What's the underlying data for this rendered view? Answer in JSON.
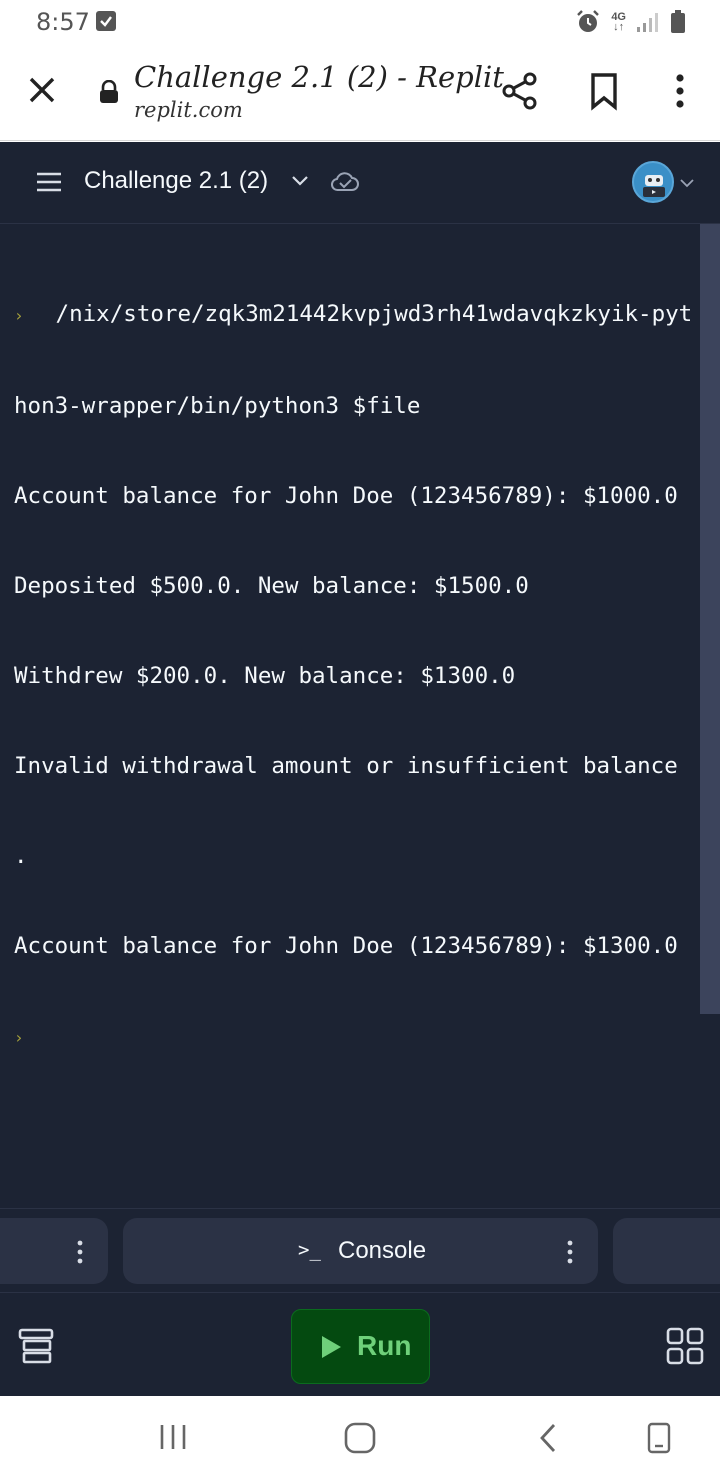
{
  "status_bar": {
    "time": "8:57",
    "network": "4G"
  },
  "browser": {
    "page_title": "Challenge 2.1 (2) - Replit",
    "url": "replit.com"
  },
  "replit": {
    "repl_name": "Challenge 2.1 (2)",
    "accent_color": "#1c2333"
  },
  "console": {
    "lines": [
      " /nix/store/zqk3m21442kvpjwd3rh41wdavqkzkyik-pyt",
      "hon3-wrapper/bin/python3 $file",
      "Account balance for John Doe (123456789): $1000.0",
      "Deposited $500.0. New balance: $1500.0",
      "Withdrew $200.0. New balance: $1300.0",
      "Invalid withdrawal amount or insufficient balance",
      ".",
      "Account balance for John Doe (123456789): $1300.0"
    ]
  },
  "tabs": {
    "console_label": "Console"
  },
  "toolbar": {
    "run_label": "Run",
    "run_color": "#6fd07a"
  },
  "icons": [
    "close-icon",
    "lock-icon",
    "share-icon",
    "bookmark-icon",
    "more-vertical-icon",
    "hamburger-icon",
    "chevron-down-icon",
    "cloud-check-icon",
    "avatar",
    "files-icon",
    "play-icon",
    "grid-icon",
    "recents-icon",
    "home-icon",
    "back-icon",
    "rotate-icon"
  ]
}
